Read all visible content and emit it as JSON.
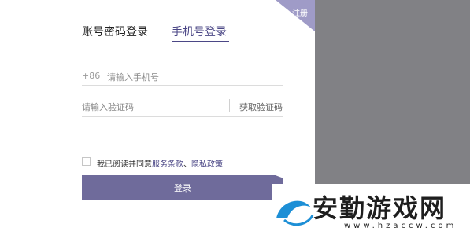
{
  "tabs": {
    "account_login": "账号密码登录",
    "phone_login": "手机号登录"
  },
  "corner": {
    "register": "注册"
  },
  "phone": {
    "prefix": "+86",
    "placeholder": "请输入手机号"
  },
  "code": {
    "placeholder": "请输入验证码",
    "get_code": "获取验证码"
  },
  "agreement": {
    "prefix": "我已阅读并同意",
    "terms": "服务条款",
    "sep": "、",
    "privacy": "隐私政策",
    "checked": false
  },
  "login_button": "登录",
  "watermark": {
    "title": "安勤游戏网",
    "url": "www.hzaccw.com"
  },
  "colors": {
    "accent": "#4b4786",
    "button": "#6f6b9b",
    "overlay": "#818185"
  }
}
